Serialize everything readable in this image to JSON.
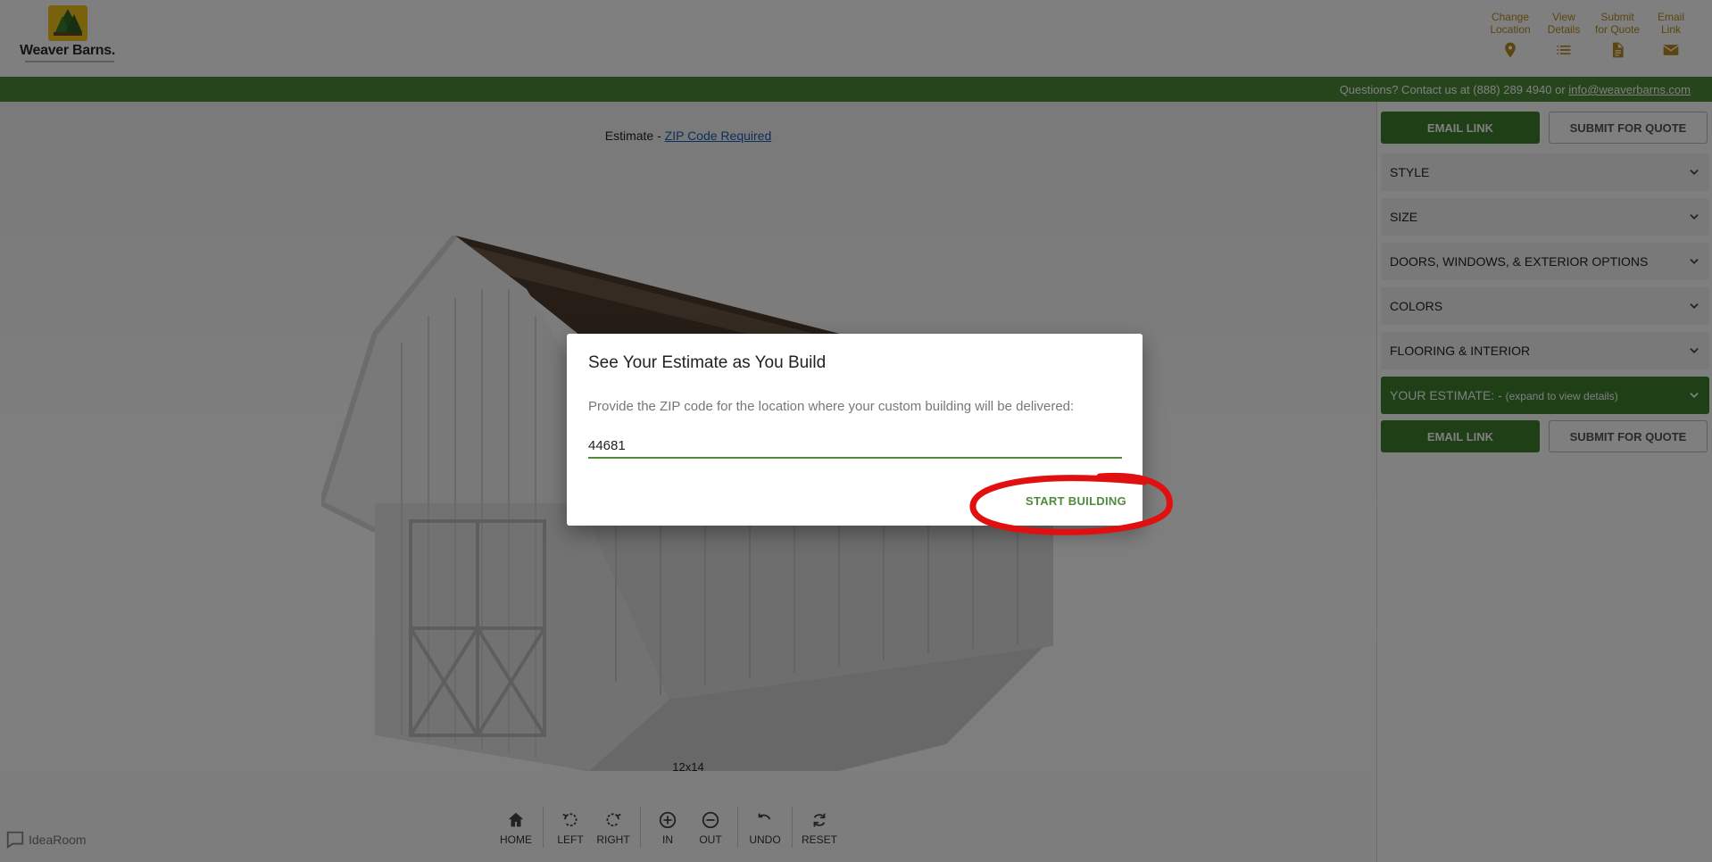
{
  "header": {
    "logo_text": "Weaver Barns.",
    "actions": [
      {
        "label": "Change Location",
        "icon": "location-pin-icon"
      },
      {
        "label": "View Details",
        "icon": "list-icon"
      },
      {
        "label": "Submit for Quote",
        "icon": "document-icon"
      },
      {
        "label": "Email Link",
        "icon": "envelope-icon"
      }
    ]
  },
  "info_bar": {
    "text": "Questions? Contact us at (888) 289 4940 or ",
    "email": "info@weaverbarns.com"
  },
  "canvas": {
    "estimate_prefix": "Estimate - ",
    "estimate_link": "ZIP Code Required",
    "size_label": "12x14",
    "toolbar": [
      {
        "label": "HOME",
        "icon": "home-icon"
      },
      {
        "label": "LEFT",
        "icon": "rotate-left-icon"
      },
      {
        "label": "RIGHT",
        "icon": "rotate-right-icon"
      },
      {
        "label": "IN",
        "icon": "zoom-in-icon"
      },
      {
        "label": "OUT",
        "icon": "zoom-out-icon"
      },
      {
        "label": "UNDO",
        "icon": "undo-icon"
      },
      {
        "label": "RESET",
        "icon": "reset-icon"
      }
    ],
    "brand": "IdeaRoom"
  },
  "panel": {
    "email_link": "EMAIL LINK",
    "submit_quote": "SUBMIT FOR QUOTE",
    "sections": [
      {
        "label": "STYLE"
      },
      {
        "label": "SIZE"
      },
      {
        "label": "DOORS, WINDOWS, & EXTERIOR OPTIONS"
      },
      {
        "label": "COLORS"
      },
      {
        "label": "FLOORING & INTERIOR"
      }
    ],
    "estimate_label": "YOUR ESTIMATE: -",
    "estimate_hint": "(expand to view details)"
  },
  "modal": {
    "title": "See Your Estimate as You Build",
    "text": "Provide the ZIP code for the location where your custom building will be delivered:",
    "zip_value": "44681",
    "start_button": "START BUILDING"
  },
  "colors": {
    "brand_green": "#4f8b3b",
    "button_green": "#3f7f2e",
    "gold": "#b88a1f",
    "annotation_red": "#e01010"
  }
}
